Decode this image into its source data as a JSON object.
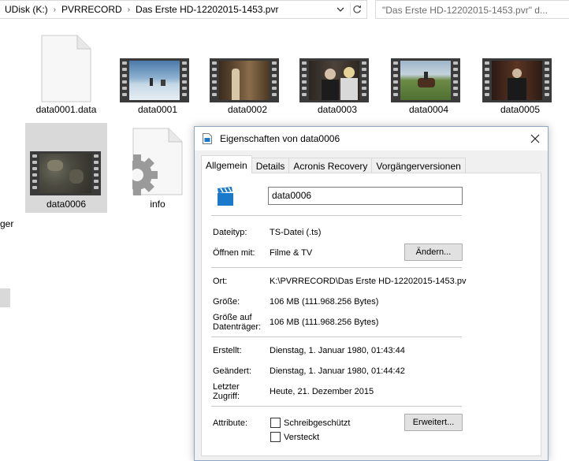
{
  "explorer": {
    "breadcrumbs": [
      "UDisk (K:)",
      "PVRRECORD",
      "Das Erste HD-12202015-1453.pvr"
    ],
    "search_placeholder": "\"Das Erste HD-12202015-1453.pvr\" d...",
    "nav_fragment": "ger",
    "files": [
      {
        "name": "data0001.data",
        "kind": "document"
      },
      {
        "name": "data0001",
        "kind": "video"
      },
      {
        "name": "data0002",
        "kind": "video"
      },
      {
        "name": "data0003",
        "kind": "video"
      },
      {
        "name": "data0004",
        "kind": "video"
      },
      {
        "name": "data0005",
        "kind": "video"
      },
      {
        "name": "data0006",
        "kind": "video",
        "selected": true
      },
      {
        "name": "info",
        "kind": "settings-document"
      }
    ]
  },
  "dialog": {
    "title": "Eigenschaften von data0006",
    "tabs": [
      "Allgemein",
      "Details",
      "Acronis Recovery",
      "Vorgängerversionen"
    ],
    "active_tab": "Allgemein",
    "file_name": "data0006",
    "dateityp_label": "Dateityp:",
    "dateityp_value": "TS-Datei (.ts)",
    "oeffnen_label": "Öffnen mit:",
    "oeffnen_value": "Filme & TV",
    "aendern_button": "Ändern...",
    "ort_label": "Ort:",
    "ort_value": "K:\\PVRRECORD\\Das Erste HD-12202015-1453.pv",
    "groesse_label": "Größe:",
    "groesse_value": "106 MB (111.968.256 Bytes)",
    "groesse_datentraeger_label_1": "Größe auf",
    "groesse_datentraeger_label_2": "Datenträger:",
    "groesse_datentraeger_value": "106 MB (111.968.256 Bytes)",
    "erstellt_label": "Erstellt:",
    "erstellt_value": "Dienstag, 1. Januar 1980, 01:43:44",
    "geaendert_label": "Geändert:",
    "geaendert_value": "Dienstag, 1. Januar 1980, 01:44:42",
    "zugriff_label_1": "Letzter",
    "zugriff_label_2": "Zugriff:",
    "zugriff_value": "Heute, 21. Dezember 2015",
    "attribute_label": "Attribute:",
    "schreibgeschuetzt_label": "Schreibgeschützt",
    "versteckt_label": "Versteckt",
    "erweitert_button": "Erweitert..."
  },
  "colors": {
    "selection": "#d9d9d9",
    "dialog_bg": "#f0f0f0",
    "dialog_border": "#8fa7c4",
    "accent_blue": "#1979ca"
  }
}
